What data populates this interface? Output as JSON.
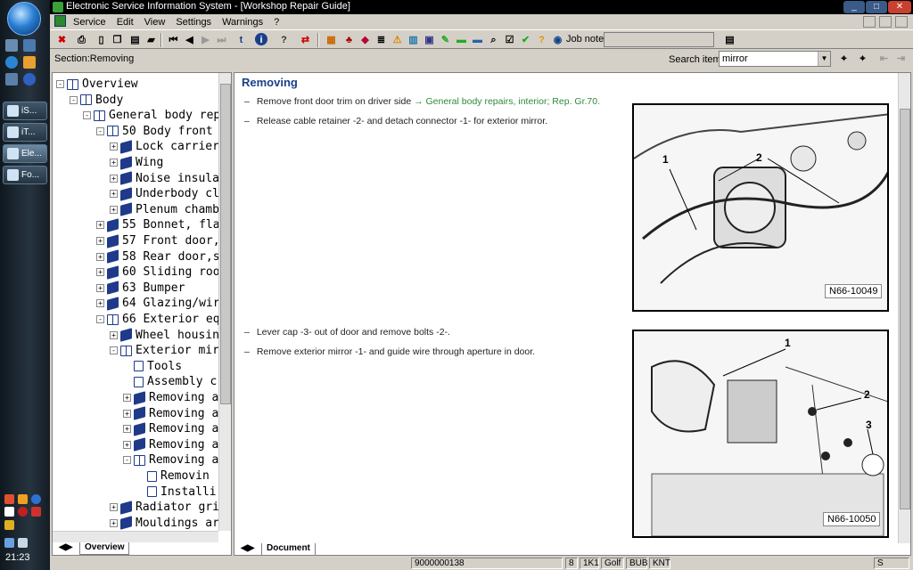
{
  "taskbar": {
    "tasks": [
      {
        "label": "iS..."
      },
      {
        "label": "iT..."
      },
      {
        "label": "Ele..."
      },
      {
        "label": "Fo..."
      }
    ],
    "clock": "21:23"
  },
  "window": {
    "title": "Electronic Service Information System - [Workshop Repair Guide]"
  },
  "menu": {
    "items": [
      "Service",
      "Edit",
      "View",
      "Settings",
      "Warnings",
      "?"
    ]
  },
  "toolbar": {
    "job_note_label": "Job note:",
    "job_note_value": ""
  },
  "section": {
    "label": "Section:Removing",
    "search_label": "Search item:",
    "search_value": "mirror"
  },
  "tree": {
    "nodes": [
      {
        "label": "Overview",
        "level": 0,
        "exp": "-",
        "icon": "open"
      },
      {
        "label": "Body",
        "level": 1,
        "exp": "-",
        "icon": "open"
      },
      {
        "label": "General body rep",
        "level": 2,
        "exp": "-",
        "icon": "open"
      },
      {
        "label": "50 Body front",
        "level": 3,
        "exp": "-",
        "icon": "open"
      },
      {
        "label": "Lock carrier",
        "level": 4,
        "exp": "+",
        "icon": "closed"
      },
      {
        "label": "Wing",
        "level": 4,
        "exp": "+",
        "icon": "closed"
      },
      {
        "label": "Noise insula",
        "level": 4,
        "exp": "+",
        "icon": "closed"
      },
      {
        "label": "Underbody cl",
        "level": 4,
        "exp": "+",
        "icon": "closed"
      },
      {
        "label": "Plenum chamb",
        "level": 4,
        "exp": "+",
        "icon": "closed"
      },
      {
        "label": "55 Bonnet, fla",
        "level": 3,
        "exp": "+",
        "icon": "closed"
      },
      {
        "label": "57 Front door,",
        "level": 3,
        "exp": "+",
        "icon": "closed"
      },
      {
        "label": "58 Rear door,s",
        "level": 3,
        "exp": "+",
        "icon": "closed"
      },
      {
        "label": "60 Sliding roo",
        "level": 3,
        "exp": "+",
        "icon": "closed"
      },
      {
        "label": "63 Bumper",
        "level": 3,
        "exp": "+",
        "icon": "closed"
      },
      {
        "label": "64 Glazing/wir",
        "level": 3,
        "exp": "+",
        "icon": "closed"
      },
      {
        "label": "66 Exterior eq",
        "level": 3,
        "exp": "-",
        "icon": "open"
      },
      {
        "label": "Wheel housin",
        "level": 4,
        "exp": "+",
        "icon": "closed"
      },
      {
        "label": "Exterior mir",
        "level": 4,
        "exp": "-",
        "icon": "open"
      },
      {
        "label": "Tools",
        "level": 5,
        "exp": "",
        "icon": "doc"
      },
      {
        "label": "Assembly c",
        "level": 5,
        "exp": "",
        "icon": "doc"
      },
      {
        "label": "Removing a",
        "level": 5,
        "exp": "+",
        "icon": "closed"
      },
      {
        "label": "Removing a",
        "level": 5,
        "exp": "+",
        "icon": "closed"
      },
      {
        "label": "Removing a",
        "level": 5,
        "exp": "+",
        "icon": "closed"
      },
      {
        "label": "Removing a",
        "level": 5,
        "exp": "+",
        "icon": "closed"
      },
      {
        "label": "Removing a",
        "level": 5,
        "exp": "-",
        "icon": "open"
      },
      {
        "label": "Removin",
        "level": 6,
        "exp": "",
        "icon": "doc"
      },
      {
        "label": "Installi",
        "level": 6,
        "exp": "",
        "icon": "doc"
      },
      {
        "label": "Radiator gri",
        "level": 4,
        "exp": "+",
        "icon": "closed"
      },
      {
        "label": "Mouldings ar",
        "level": 4,
        "exp": "+",
        "icon": "closed"
      }
    ]
  },
  "left_tabs": {
    "overview": "Overview"
  },
  "content": {
    "title": "Removing",
    "steps1": [
      {
        "prefix": "–",
        "text": "Remove front door trim on driver side ",
        "link": "→ General body repairs, interior; Rep. Gr.70."
      },
      {
        "prefix": "–",
        "text": "Release cable retainer -2- and detach connector -1- for exterior mirror.",
        "link": ""
      }
    ],
    "steps2": [
      {
        "prefix": "–",
        "text": "Lever cap -3- out of door and remove bolts -2-.",
        "link": ""
      },
      {
        "prefix": "–",
        "text": "Remove exterior mirror -1- and guide wire through aperture in door.",
        "link": ""
      }
    ],
    "figure1": {
      "label": "N66-10049",
      "callouts": [
        "1",
        "2"
      ]
    },
    "figure2": {
      "label": "N66-10050",
      "callouts": [
        "1",
        "2",
        "3"
      ]
    }
  },
  "right_tabs": {
    "document": "Document"
  },
  "status": {
    "code": "9000000138",
    "fields": [
      "8",
      "1K1",
      "Golf",
      "BUB",
      "KNT"
    ],
    "mode": "S"
  }
}
